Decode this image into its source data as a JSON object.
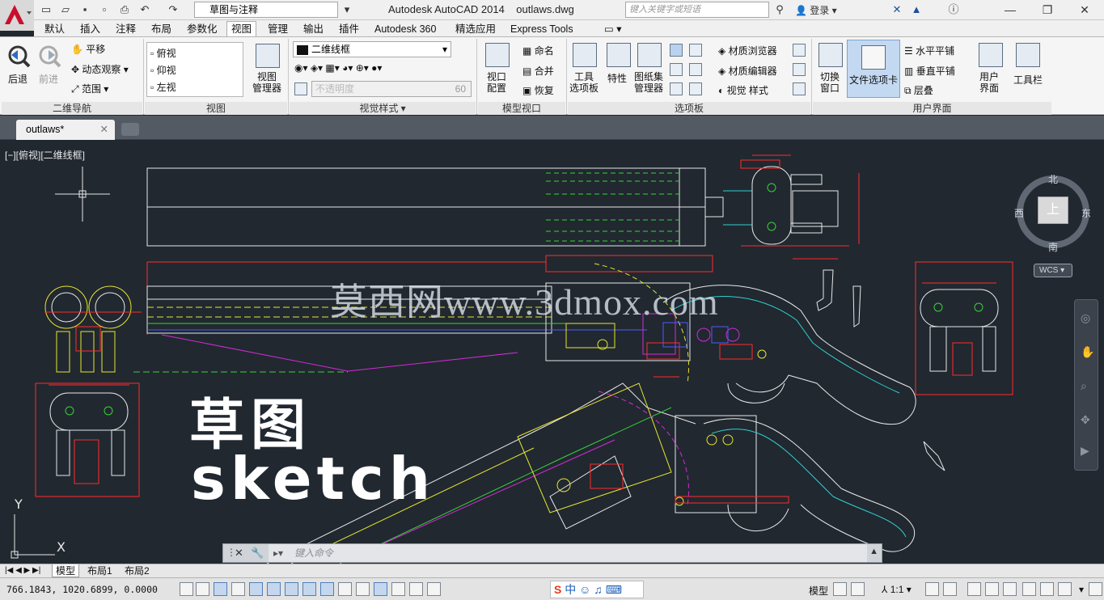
{
  "titlebar": {
    "workspace": "草图与注释",
    "app_title": "Autodesk AutoCAD 2014",
    "file_name": "outlaws.dwg",
    "search_placeholder": "键入关键字或短语",
    "login": "登录"
  },
  "menu_tabs": [
    "默认",
    "插入",
    "注释",
    "布局",
    "参数化",
    "视图",
    "管理",
    "输出",
    "插件",
    "Autodesk 360",
    "精选应用",
    "Express Tools"
  ],
  "active_tab": "视图",
  "ribbon": {
    "nav2d": {
      "back": "后退",
      "forward": "前进",
      "pan": "平移",
      "orbit": "动态观察",
      "extents": "范围",
      "title": "二维导航"
    },
    "views": {
      "items": [
        "俯视",
        "仰视",
        "左视"
      ],
      "manager": "视图\n管理器",
      "title": "视图"
    },
    "visual_styles": {
      "style": "二维线框",
      "hint": "不透明度",
      "opacity_value": "60",
      "title": "视觉样式"
    },
    "model_viewports": {
      "config": "视口\n配置",
      "named": "命名",
      "join": "合并",
      "restore": "恢复",
      "title": "模型视口"
    },
    "palettes": {
      "tool_palettes": "工具\n选项板",
      "properties": "特性",
      "sheet_set": "图纸集\n管理器",
      "materials_browser": "材质浏览器",
      "materials_editor": "材质编辑器",
      "visual_styles": "视觉 样式",
      "title": "选项板"
    },
    "ui": {
      "switch_windows": "切换\n窗口",
      "file_tabs": "文件选项卡",
      "tile_h": "水平平铺",
      "tile_v": "垂直平铺",
      "cascade": "层叠",
      "user_interface": "用户\n界面",
      "toolbars": "工具栏",
      "title": "用户界面"
    }
  },
  "document_tab": "outlaws*",
  "canvas": {
    "view_label": "[−][俯视][二维线框]",
    "watermark": "莫西网www.3dmox.com",
    "sketch_zh": "草图",
    "sketch_en": "sketch",
    "compass": {
      "north": "北",
      "south": "南",
      "east": "东",
      "west": "西",
      "top": "上"
    },
    "wcs": "WCS"
  },
  "command_line": {
    "placeholder": "键入命令"
  },
  "layout_tabs": [
    "模型",
    "布局1",
    "布局2"
  ],
  "statusbar": {
    "coords": "766.1843,  1020.6899, 0.0000",
    "model": "模型",
    "scale": "1:1"
  },
  "colors": {
    "canvas_bg": "#212830",
    "red": "#ff2b2b",
    "white": "#e8e8e8",
    "green": "#39d239",
    "yellow": "#e6e62e",
    "cyan": "#2fd0d0",
    "blue": "#4a5cff",
    "magenta": "#d42ad4"
  }
}
